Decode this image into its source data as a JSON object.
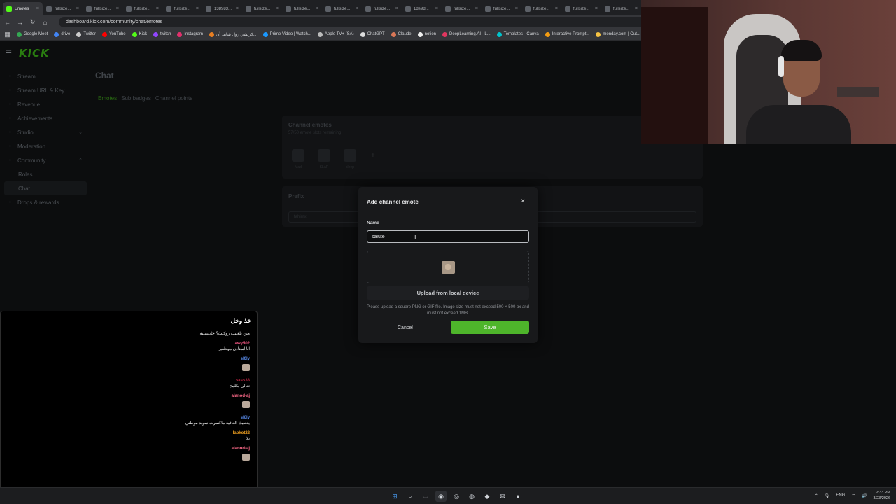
{
  "browser": {
    "tabs": [
      {
        "title": "Emotes",
        "active": true
      },
      {
        "title": "fullsize..."
      },
      {
        "title": "fullsize..."
      },
      {
        "title": "fullsize..."
      },
      {
        "title": "fullsize..."
      },
      {
        "title": "138983..."
      },
      {
        "title": "fullsize..."
      },
      {
        "title": "fullsize..."
      },
      {
        "title": "fullsize..."
      },
      {
        "title": "fullsize..."
      },
      {
        "title": "1de9d..."
      },
      {
        "title": "fullsize..."
      },
      {
        "title": "fullsize..."
      },
      {
        "title": "fullsize..."
      },
      {
        "title": "fullsize..."
      },
      {
        "title": "fullsize..."
      }
    ],
    "url": "dashboard.kick.com/community/chat/emotes",
    "bookmarks": [
      {
        "label": "Google Meet",
        "color": "#34a853"
      },
      {
        "label": "drive",
        "color": "#4285f4"
      },
      {
        "label": "Twitter",
        "color": "#cccccc"
      },
      {
        "label": "YouTube",
        "color": "#ff0000"
      },
      {
        "label": "Kick",
        "color": "#53fc18"
      },
      {
        "label": "twitch",
        "color": "#9146ff"
      },
      {
        "label": "Instagram",
        "color": "#e1306c"
      },
      {
        "label": "كرتشي رول شاهد أن...",
        "color": "#e67e22"
      },
      {
        "label": "Prime Video | Watch...",
        "color": "#1a98ff"
      },
      {
        "label": "Apple TV+ (SA)",
        "color": "#bbbbbb"
      },
      {
        "label": "ChatGPT",
        "color": "#dddddd"
      },
      {
        "label": "Claude",
        "color": "#d97757"
      },
      {
        "label": "notion",
        "color": "#eeeeee"
      },
      {
        "label": "DeepLearning.AI - L...",
        "color": "#e0365f"
      },
      {
        "label": "Templates - Canva",
        "color": "#00c4cc"
      },
      {
        "label": "Interactive Prompt...",
        "color": "#f39c12"
      },
      {
        "label": "monday.com | Out...",
        "color": "#f6c343"
      }
    ]
  },
  "dashboard": {
    "logo": "KICK",
    "nav": [
      {
        "label": "Stream",
        "icon": "•"
      },
      {
        "label": "Stream URL & Key",
        "icon": "•"
      },
      {
        "label": "Revenue",
        "icon": "•"
      },
      {
        "label": "Achievements",
        "icon": "•"
      },
      {
        "label": "Studio",
        "icon": "•",
        "chev": "⌄"
      },
      {
        "label": "Moderation",
        "icon": "•"
      },
      {
        "label": "Community",
        "icon": "•",
        "chev": "⌃"
      },
      {
        "label": "Roles",
        "sub": true
      },
      {
        "label": "Chat",
        "sub": true,
        "active": true
      },
      {
        "label": "Drops & rewards",
        "icon": "•"
      }
    ],
    "page_title": "Chat",
    "subtabs": [
      {
        "label": "Emotes",
        "active": true
      },
      {
        "label": "Sub badges"
      },
      {
        "label": "Channel points"
      }
    ],
    "channel_emotes": {
      "title": "Channel emotes",
      "subtitle": "57/50 emote slots remaining",
      "emotes": [
        "Mad",
        "SLAP",
        "sleep"
      ],
      "add": "+"
    },
    "prefix": {
      "title": "Prefix",
      "value": "fahimx"
    }
  },
  "modal": {
    "title": "Add channel emote",
    "close": "×",
    "name_label": "Name",
    "name_value": "salute",
    "upload_label": "Upload from local device",
    "note": "Please upload a square PNG or GIF file. Image size must not exceed 500 × 500 px and must not exceed 1MB.",
    "cancel": "Cancel",
    "save": "Save"
  },
  "chat": {
    "title": "خذ وخل",
    "messages": [
      {
        "user": "",
        "text": "مين يلعبيب روكيت؟ خايبيبيبيه",
        "color": "#ffffff"
      },
      {
        "user": "awy502",
        "text": "انا استأذن موظفين",
        "color": "#ff5c8a"
      },
      {
        "user": "sl0ly",
        "text": "",
        "emote": true,
        "color": "#5a8dee"
      },
      {
        "user": "sass38",
        "text": "تعالي يكلمج",
        "color": "#b0223c"
      },
      {
        "user": "alanod-aj",
        "text": "",
        "emote": true,
        "color": "#ff6b8a"
      },
      {
        "user": "sl0ly",
        "text": "يعطيك العافية ماكسرت سويد موطني",
        "color": "#5a8dee"
      },
      {
        "user": "lapkot22",
        "text": "يلا",
        "color": "#f0a020"
      },
      {
        "user": "alanod-aj",
        "text": "",
        "emote": true,
        "color": "#ff6b8a"
      }
    ]
  },
  "taskbar": {
    "apps": [
      "windows-start",
      "search",
      "files",
      "chrome",
      "discord",
      "steam",
      "vpn",
      "mail",
      "obs"
    ],
    "tray_lang": "ENG",
    "time": "2:33 PM",
    "date": "3/23/2026"
  },
  "colors": {
    "accent": "#53fc18",
    "save_button": "#4eb52b"
  }
}
